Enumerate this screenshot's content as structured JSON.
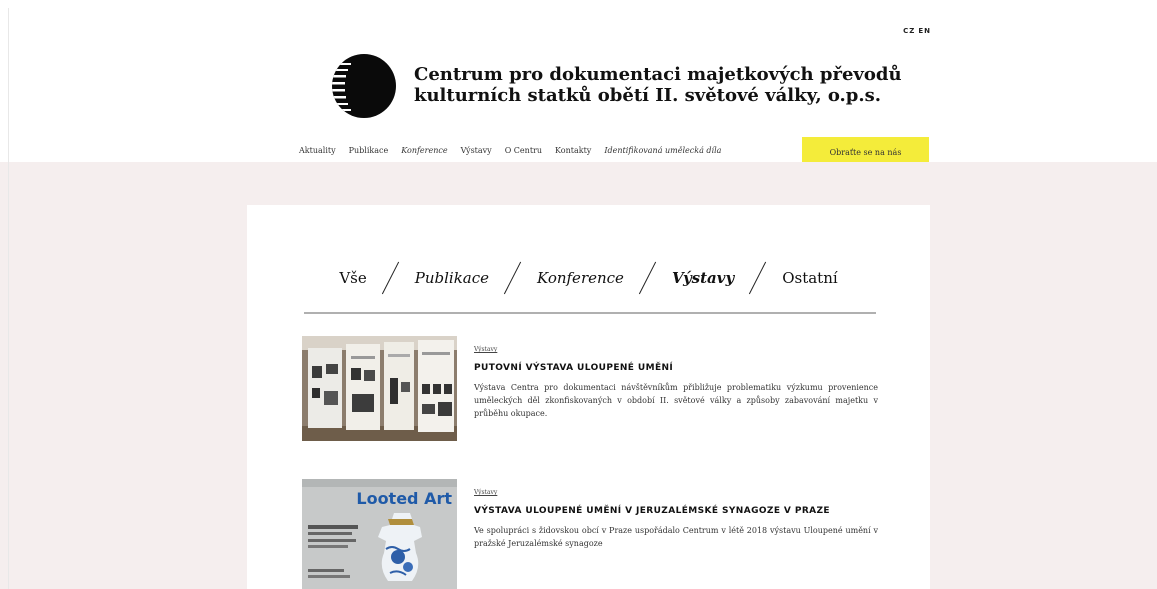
{
  "header": {
    "lang": [
      "CZ",
      "EN"
    ],
    "title_line1": "Centrum pro dokumentaci majetkových převodů",
    "title_line2": "kulturních statků obětí II. světové války, o.p.s."
  },
  "nav": {
    "items": [
      {
        "label": "Aktuality",
        "italic": false
      },
      {
        "label": "Publikace",
        "italic": false
      },
      {
        "label": "Konference",
        "italic": true
      },
      {
        "label": "Výstavy",
        "italic": false
      },
      {
        "label": "O Centru",
        "italic": false
      },
      {
        "label": "Kontakty",
        "italic": false
      },
      {
        "label": "Identifikovaná umělecká díla",
        "italic": true
      }
    ],
    "contact_button": "Obraťte se na nás",
    "accent_color": "#f4ec3a"
  },
  "filters": {
    "items": [
      "Vše",
      "Publikace",
      "Konference",
      "Výstavy",
      "Ostatní"
    ],
    "active": "Výstavy"
  },
  "articles": [
    {
      "category": "Výstavy",
      "title": "PUTOVNÍ VÝSTAVA ULOUPENÉ UMĚNÍ",
      "description": "Výstava Centra pro dokumentaci návštěvníkům přibližuje problematiku výzkumu provenience uměleckých děl zkonfiskovaných v období II. světové války a způsoby zabavování majetku v průběhu okupace."
    },
    {
      "category": "Výstavy",
      "title": "VÝSTAVA ULOUPENÉ UMĚNÍ V JERUZALÉMSKÉ SYNAGOZE V PRAZE",
      "description": "Ve spolupráci s židovskou obcí v Praze uspořádalo Centrum v létě 2018 výstavu Uloupené umění v pražské Jeruzalémské synagoze",
      "image_text": "Looted Art"
    }
  ]
}
